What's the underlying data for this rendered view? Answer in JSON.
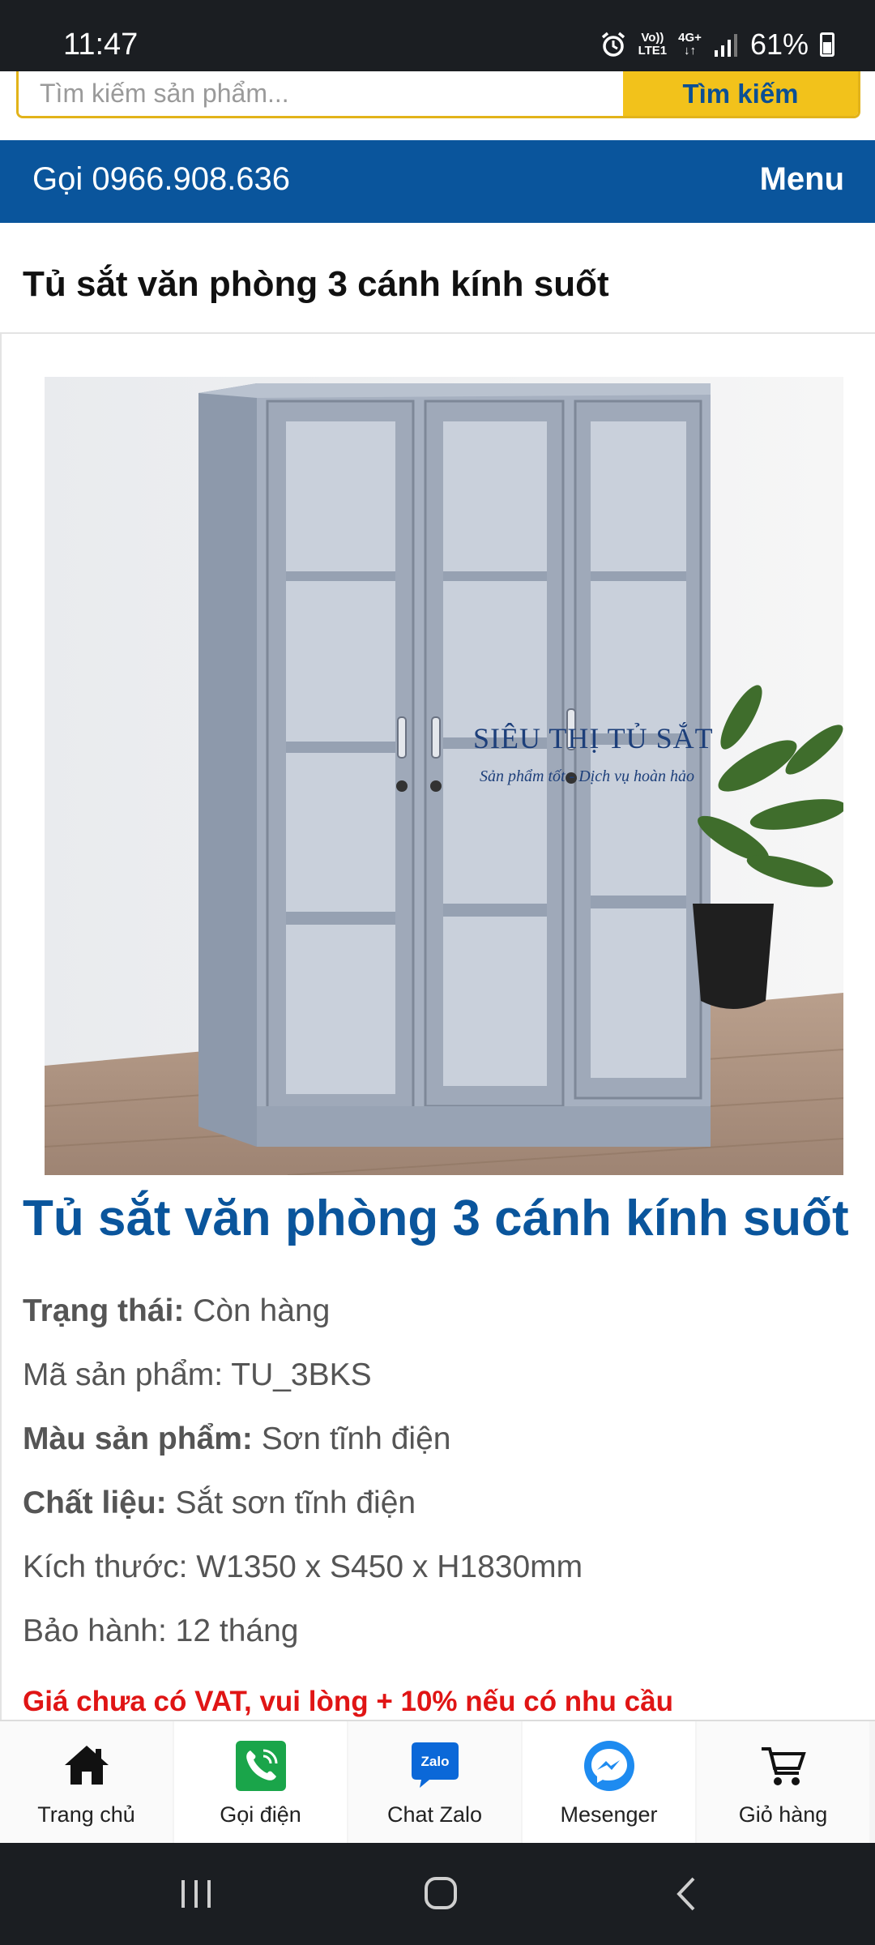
{
  "status_bar": {
    "time": "11:47",
    "network_top": "Vo))",
    "network_bottom": "LTE1",
    "signal_label": "4G+",
    "battery": "61%"
  },
  "search": {
    "placeholder": "Tìm kiếm sản phẩm...",
    "button_label": "Tìm kiếm"
  },
  "header": {
    "call_label": "Gọi 0966.908.636",
    "menu_label": "Menu"
  },
  "page": {
    "heading": "Tủ sắt văn phòng 3 cánh kính suốt"
  },
  "product": {
    "title": "Tủ sắt văn phòng 3 cánh kính suốt",
    "watermark_title": "SIÊU THỊ TỦ SẮT",
    "watermark_subtitle": "Sản phẩm tốt - Dịch vụ hoàn hảo",
    "specs": [
      {
        "label": "Trạng thái:",
        "value": " Còn hàng"
      },
      {
        "label": "",
        "value": "Mã sản phẩm: TU_3BKS"
      },
      {
        "label": "Màu sản phẩm:",
        "value": " Sơn tĩnh điện"
      },
      {
        "label": "Chất liệu:",
        "value": " Sắt sơn tĩnh điện"
      },
      {
        "label": "",
        "value": "Kích thước: W1350 x S450 x H1830mm"
      },
      {
        "label": "",
        "value": "Bảo hành: 12 tháng"
      }
    ],
    "vat_note": "Giá chưa có VAT, vui lòng + 10% nếu có nhu cầu"
  },
  "bottom_nav": [
    {
      "label": "Trang chủ",
      "icon": "home-icon"
    },
    {
      "label": "Gọi điện",
      "icon": "phone-icon"
    },
    {
      "label": "Chat Zalo",
      "icon": "zalo-icon",
      "icon_text": "Zalo"
    },
    {
      "label": "Mesenger",
      "icon": "messenger-icon"
    },
    {
      "label": "Giỏ hàng",
      "icon": "cart-icon"
    }
  ],
  "colors": {
    "primary_blue": "#0a559c",
    "search_yellow": "#f2c21b",
    "warning_red": "#e01515",
    "phone_green": "#1aa54a",
    "zalo_blue": "#0b68d8",
    "messenger_blue": "#1e8bf0"
  }
}
